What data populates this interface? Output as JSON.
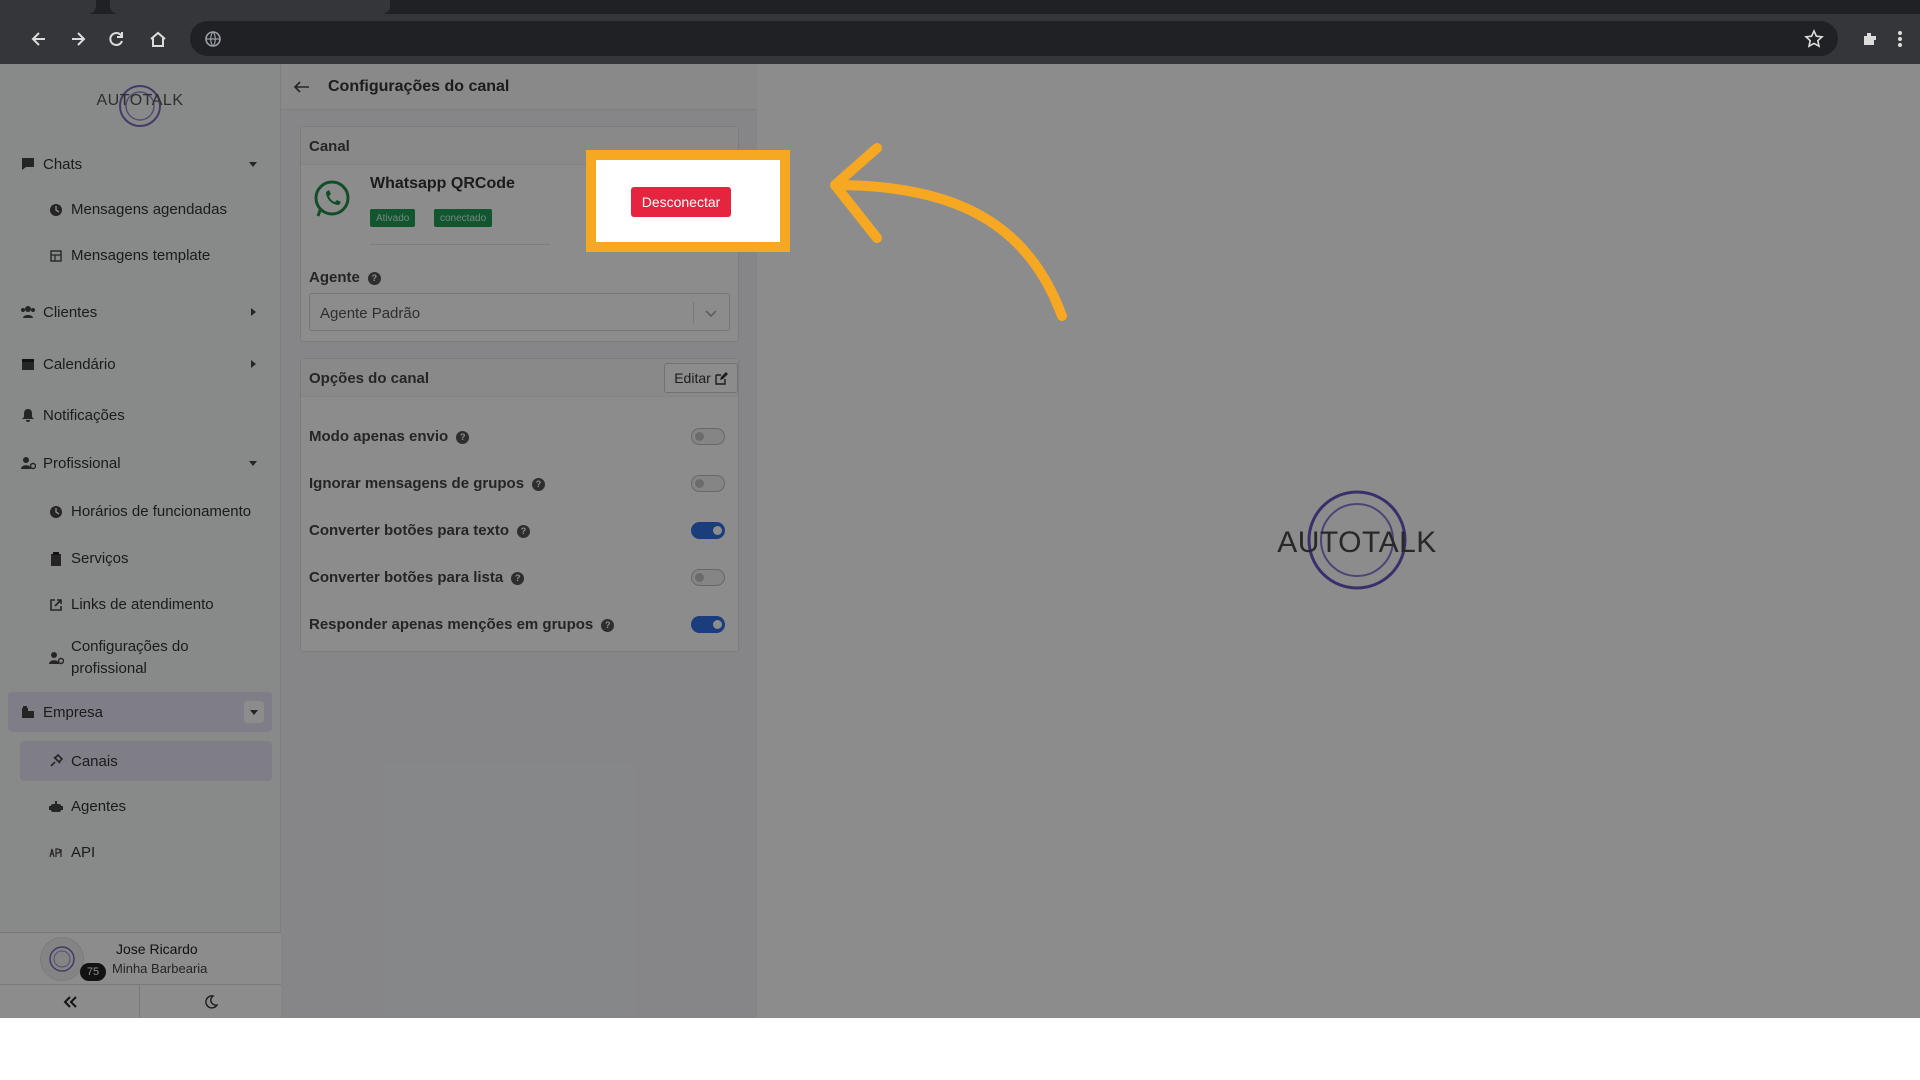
{
  "browser": {
    "icons": [
      "back-icon",
      "forward-icon",
      "reload-icon",
      "home-icon",
      "site-info-icon",
      "bookmark-star-icon",
      "extensions-icon",
      "menu-icon"
    ]
  },
  "sidebar": {
    "logo": "AUTOTALK",
    "items": [
      {
        "label": "Chats",
        "icon": "chat-icon"
      },
      {
        "label": "Mensagens agendadas",
        "icon": "clock-icon"
      },
      {
        "label": "Mensagens template",
        "icon": "template-icon"
      },
      {
        "label": "Clientes",
        "icon": "users-icon"
      },
      {
        "label": "Calendário",
        "icon": "calendar-icon"
      },
      {
        "label": "Notificações",
        "icon": "bell-icon"
      },
      {
        "label": "Profissional",
        "icon": "user-gear-icon"
      },
      {
        "label": "Horários de funcionamento",
        "icon": "clock-icon"
      },
      {
        "label": "Serviços",
        "icon": "clipboard-icon"
      },
      {
        "label": "Links de atendimento",
        "icon": "external-link-icon"
      },
      {
        "label": "Configurações do profissional",
        "icon": "user-gear-icon"
      },
      {
        "label": "Empresa",
        "icon": "building-icon"
      },
      {
        "label": "Canais",
        "icon": "plug-icon"
      },
      {
        "label": "Agentes",
        "icon": "robot-icon"
      },
      {
        "label": "API",
        "icon": "api-icon"
      }
    ],
    "user": {
      "name": "Jose Ricardo",
      "company": "Minha Barbearia",
      "badge": "75"
    }
  },
  "content": {
    "title": "Configurações do canal",
    "canal": {
      "header": "Canal",
      "name": "Whatsapp QRCode",
      "tags": [
        "Ativado",
        "conectado"
      ],
      "disconnect_label": "Desconectar",
      "agent_label": "Agente",
      "agent_value": "Agente Padrão"
    },
    "options": {
      "header": "Opções do canal",
      "edit_label": "Editar",
      "items": [
        {
          "label": "Modo apenas envio",
          "on": false
        },
        {
          "label": "Ignorar mensagens de grupos",
          "on": false
        },
        {
          "label": "Converter botões para texto",
          "on": true
        },
        {
          "label": "Converter botões para lista",
          "on": false
        },
        {
          "label": "Responder apenas menções em grupos",
          "on": true
        }
      ]
    }
  },
  "main": {
    "logo": "AUTOTALK"
  },
  "colors": {
    "highlight": "#f7a823",
    "disconnect": "#e5243f",
    "toggle_on": "#2f6fe4",
    "tag": "#1f9d55"
  }
}
